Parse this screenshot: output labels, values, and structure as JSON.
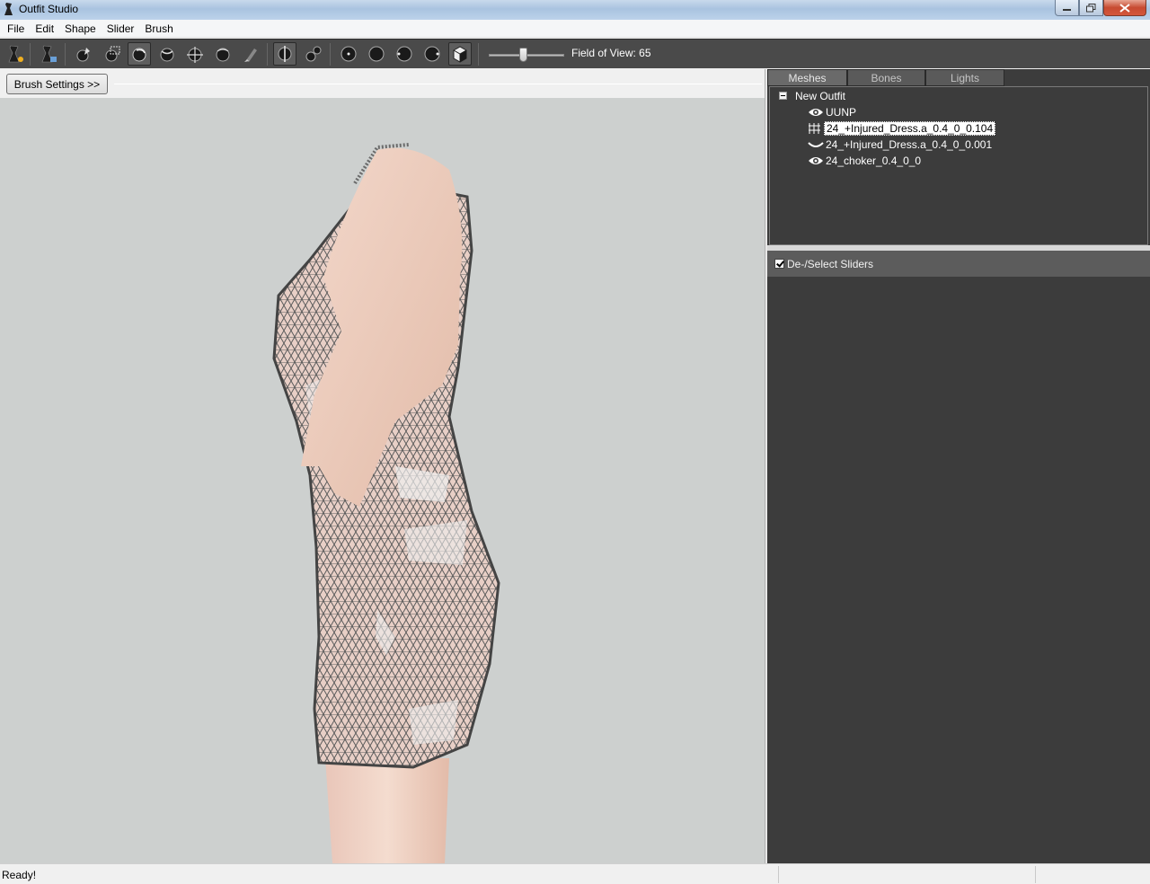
{
  "window": {
    "title": "Outfit Studio"
  },
  "menu": [
    "File",
    "Edit",
    "Shape",
    "Slider",
    "Brush"
  ],
  "toolbar": {
    "fov_label": "Field of View: 65",
    "fov_value": 65,
    "tools": [
      "new-project-icon",
      "load-reference-icon",
      "select-brush-icon",
      "mask-brush-icon",
      "inflate-brush-icon",
      "deflate-brush-icon",
      "move-brush-icon",
      "smooth-brush-icon",
      "weight-brush-icon",
      "x-mirror-icon",
      "connected-only-icon",
      "front-view-icon",
      "back-view-icon",
      "left-view-icon",
      "right-view-icon",
      "perspective-icon"
    ]
  },
  "left": {
    "brush_settings_label": "Brush Settings >>"
  },
  "right": {
    "tabs": [
      "Meshes",
      "Bones",
      "Lights"
    ],
    "active_tab": "Meshes",
    "tree": {
      "root": "New Outfit",
      "items": [
        {
          "label": "UUNP",
          "icon": "eye-icon",
          "selected": false
        },
        {
          "label": "24_+Injured_Dress.a_0.4_0_0.104",
          "icon": "wireframe-icon",
          "selected": true
        },
        {
          "label": "24_+Injured_Dress.a_0.4_0_0.001",
          "icon": "hidden-eye-icon",
          "selected": false
        },
        {
          "label": "24_choker_0.4_0_0",
          "icon": "eye-icon",
          "selected": false
        }
      ]
    },
    "sliders_label": "De-/Select Sliders",
    "sliders_checked": true
  },
  "status": {
    "text": "Ready!"
  },
  "colors": {
    "toolbar_bg": "#4a4a4a",
    "panel_bg": "#3c3c3c",
    "viewport_bg": "#cdd0cf"
  }
}
